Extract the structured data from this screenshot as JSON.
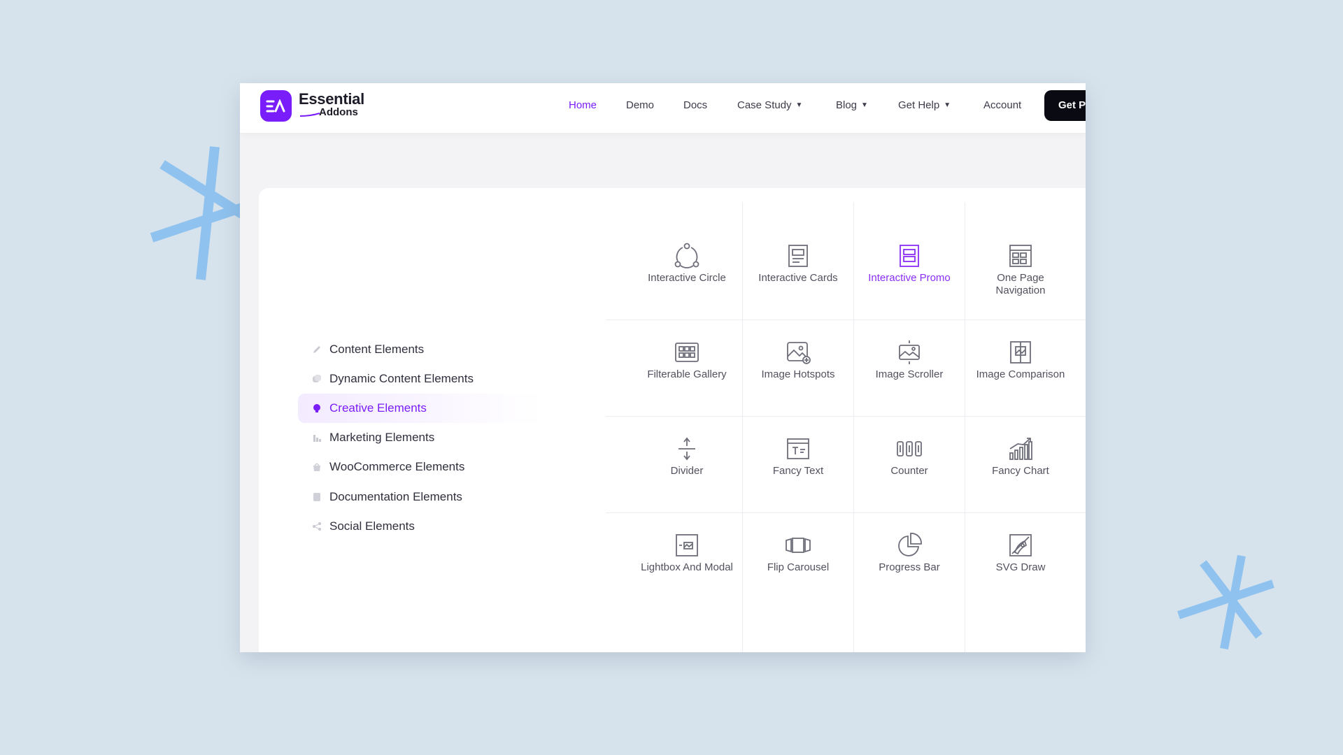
{
  "colors": {
    "accent": "#7a1dfb",
    "background": "#d7e3ec",
    "text": "#2f2f3d",
    "icon": "#6e6e7a"
  },
  "brand": {
    "logo_mark": "EA",
    "name_line1": "Essential",
    "name_line2": "Addons"
  },
  "nav": {
    "home": "Home",
    "demo": "Demo",
    "docs": "Docs",
    "case_study": "Case Study",
    "blog": "Blog",
    "get_help": "Get Help",
    "account": "Account",
    "cta": "Get P"
  },
  "sidebar": {
    "items": [
      {
        "label": "Content Elements",
        "icon": "pencil-icon"
      },
      {
        "label": "Dynamic Content Elements",
        "icon": "layers-icon"
      },
      {
        "label": "Creative Elements",
        "icon": "bulb-icon",
        "active": true
      },
      {
        "label": "Marketing Elements",
        "icon": "bar-chart-icon"
      },
      {
        "label": "WooCommerce Elements",
        "icon": "basket-icon"
      },
      {
        "label": "Documentation Elements",
        "icon": "document-icon"
      },
      {
        "label": "Social Elements",
        "icon": "share-icon"
      }
    ]
  },
  "widgets": [
    {
      "label": "Interactive Circle",
      "icon": "interactive-circle-icon"
    },
    {
      "label": "Interactive Cards",
      "icon": "interactive-cards-icon"
    },
    {
      "label": "Interactive Promo",
      "icon": "interactive-promo-icon",
      "active": true
    },
    {
      "label": "One Page Navigation",
      "icon": "one-page-navigation-icon"
    },
    {
      "label": "Filterable Gallery",
      "icon": "filterable-gallery-icon"
    },
    {
      "label": "Image Hotspots",
      "icon": "image-hotspots-icon"
    },
    {
      "label": "Image Scroller",
      "icon": "image-scroller-icon"
    },
    {
      "label": "Image Comparison",
      "icon": "image-comparison-icon"
    },
    {
      "label": "Divider",
      "icon": "divider-icon"
    },
    {
      "label": "Fancy Text",
      "icon": "fancy-text-icon"
    },
    {
      "label": "Counter",
      "icon": "counter-icon"
    },
    {
      "label": "Fancy Chart",
      "icon": "fancy-chart-icon"
    },
    {
      "label": "Lightbox And Modal",
      "icon": "lightbox-modal-icon"
    },
    {
      "label": "Flip Carousel",
      "icon": "flip-carousel-icon"
    },
    {
      "label": "Progress Bar",
      "icon": "progress-bar-icon"
    },
    {
      "label": "SVG Draw",
      "icon": "svg-draw-icon"
    }
  ]
}
